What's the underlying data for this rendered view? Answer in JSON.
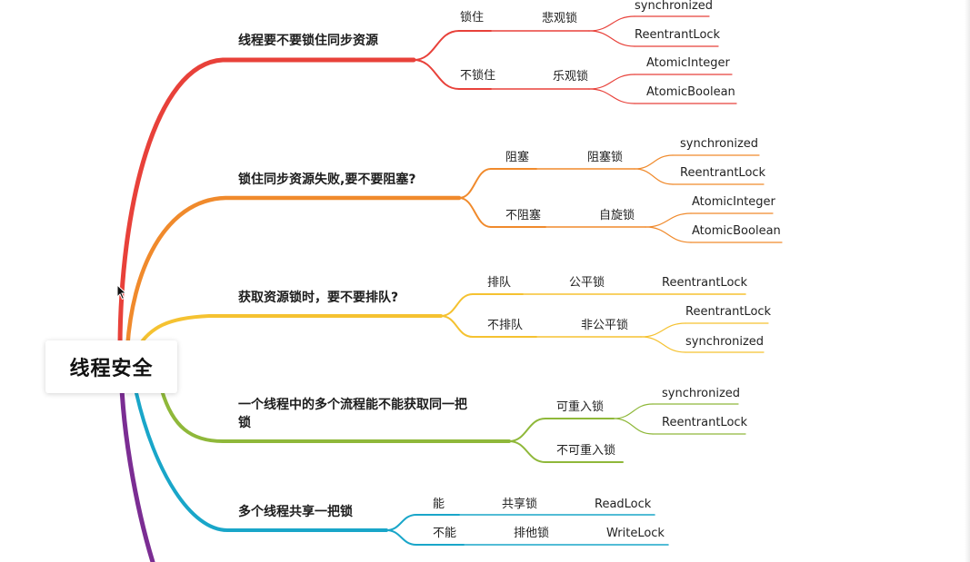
{
  "root": {
    "label": "线程安全"
  },
  "colors": {
    "red": "#e8413a",
    "orange": "#f08a2c",
    "yellow": "#f5c231",
    "green": "#8fb83a",
    "blue": "#19a6c9",
    "purple": "#7b2d93"
  },
  "branches": [
    {
      "label": "线程要不要锁住同步资源",
      "children": [
        {
          "label": "锁住",
          "children": [
            {
              "label": "悲观锁",
              "children": [
                {
                  "label": "synchronized"
                },
                {
                  "label": "ReentrantLock"
                }
              ]
            }
          ]
        },
        {
          "label": "不锁住",
          "children": [
            {
              "label": "乐观锁",
              "children": [
                {
                  "label": "AtomicInteger"
                },
                {
                  "label": "AtomicBoolean"
                }
              ]
            }
          ]
        }
      ]
    },
    {
      "label": "锁住同步资源失败,要不要阻塞?",
      "children": [
        {
          "label": "阻塞",
          "children": [
            {
              "label": "阻塞锁",
              "children": [
                {
                  "label": "synchronized"
                },
                {
                  "label": "ReentrantLock"
                }
              ]
            }
          ]
        },
        {
          "label": "不阻塞",
          "children": [
            {
              "label": "自旋锁",
              "children": [
                {
                  "label": "AtomicInteger"
                },
                {
                  "label": "AtomicBoolean"
                }
              ]
            }
          ]
        }
      ]
    },
    {
      "label": "获取资源锁时，要不要排队?",
      "children": [
        {
          "label": "排队",
          "children": [
            {
              "label": "公平锁",
              "children": [
                {
                  "label": "ReentrantLock"
                }
              ]
            }
          ]
        },
        {
          "label": "不排队",
          "children": [
            {
              "label": "非公平锁",
              "children": [
                {
                  "label": "ReentrantLock"
                },
                {
                  "label": "synchronized"
                }
              ]
            }
          ]
        }
      ]
    },
    {
      "label_line1": "一个线程中的多个流程能不能获取同一把",
      "label_line2": "锁",
      "children": [
        {
          "label": "可重入锁",
          "children": [
            {
              "label": "synchronized"
            },
            {
              "label": "ReentrantLock"
            }
          ]
        },
        {
          "label": "不可重入锁"
        }
      ]
    },
    {
      "label": "多个线程共享一把锁",
      "children": [
        {
          "label": "能",
          "children": [
            {
              "label": "共享锁",
              "children": [
                {
                  "label": "ReadLock"
                }
              ]
            }
          ]
        },
        {
          "label": "不能",
          "children": [
            {
              "label": "排他锁",
              "children": [
                {
                  "label": "WriteLock"
                }
              ]
            }
          ]
        }
      ]
    }
  ]
}
